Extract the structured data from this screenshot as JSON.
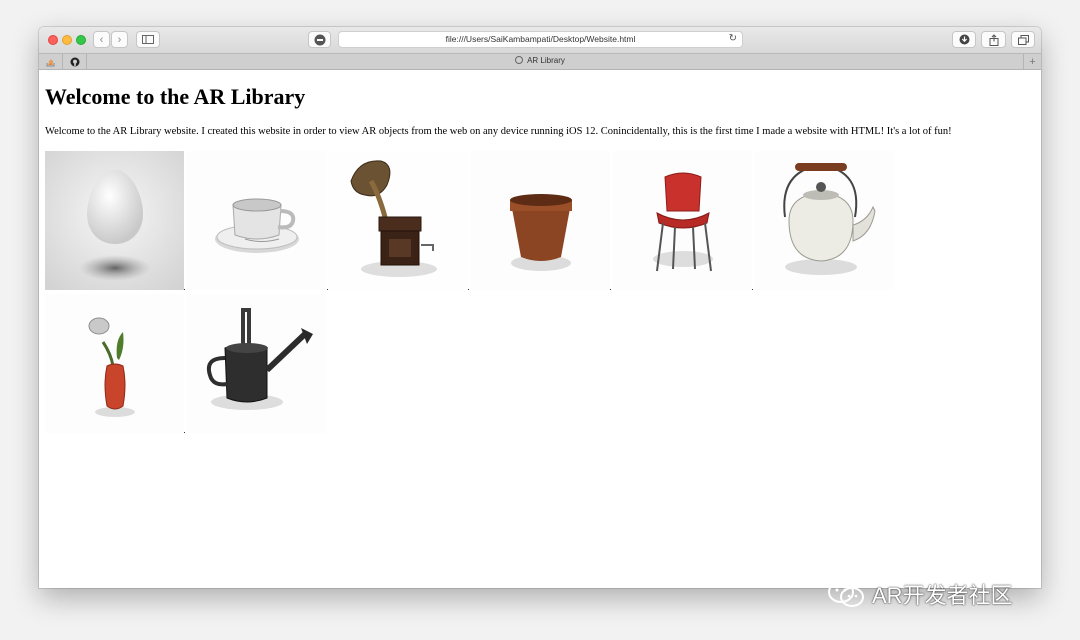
{
  "browser": {
    "url": "file:///Users/SaiKambampati/Desktop/Website.html",
    "tab_title": "AR Library",
    "new_tab_symbol": "+"
  },
  "page": {
    "heading": "Welcome to the AR Library",
    "intro": "Welcome to the AR Library website. I created this website in order to view AR objects from the web on any device running iOS 12. Conincidentally, this is the first time I made a website with HTML! It's a lot of fun!"
  },
  "watermark": {
    "text": "AR开发者社区"
  }
}
